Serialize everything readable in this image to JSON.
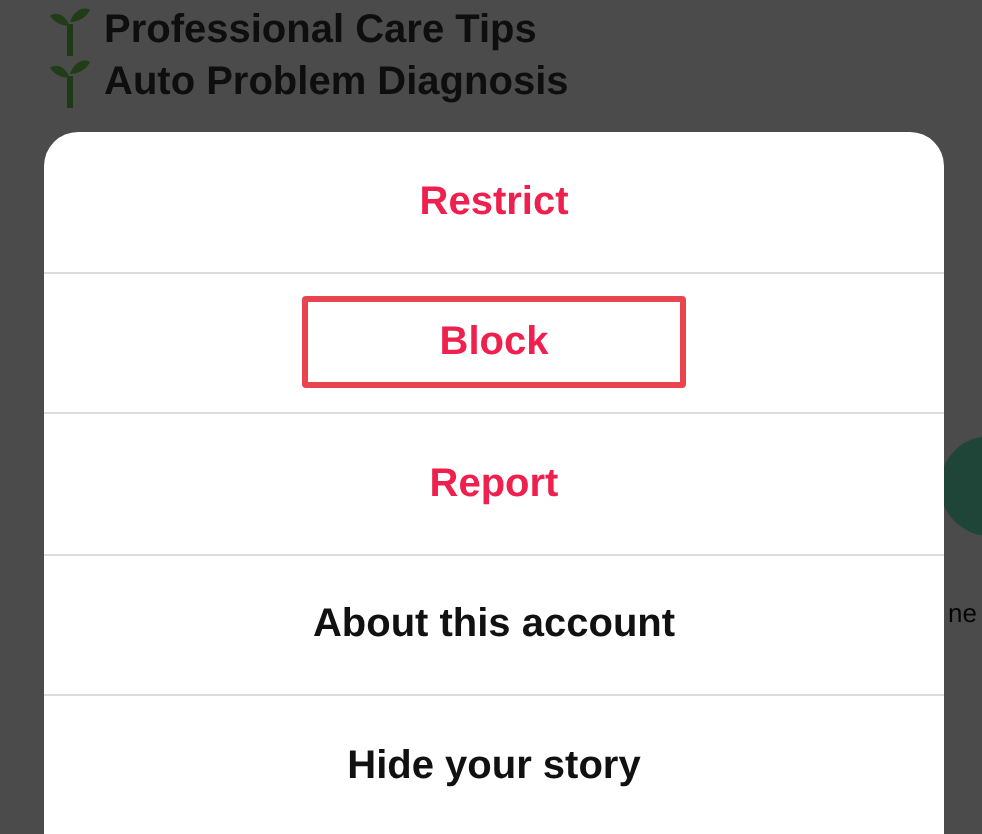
{
  "background": {
    "features": [
      "Professional Care Tips",
      "Auto Problem Diagnosis"
    ],
    "side_label": "ne"
  },
  "action_sheet": {
    "options": [
      {
        "label": "Restrict",
        "kind": "destructive",
        "highlighted": false
      },
      {
        "label": "Block",
        "kind": "destructive",
        "highlighted": true
      },
      {
        "label": "Report",
        "kind": "destructive",
        "highlighted": false
      },
      {
        "label": "About this account",
        "kind": "default",
        "highlighted": false
      },
      {
        "label": "Hide your story",
        "kind": "default",
        "highlighted": false
      }
    ]
  }
}
